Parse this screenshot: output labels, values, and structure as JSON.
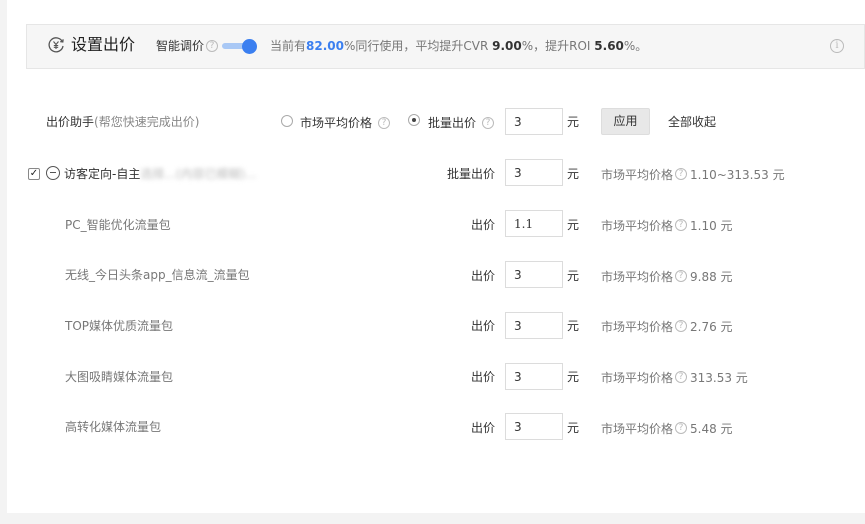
{
  "header": {
    "title": "设置出价",
    "smart_label": "智能调价",
    "stats_prefix": "当前有",
    "stats_pct": "82.00",
    "stats_mid": "%同行使用，平均提升CVR ",
    "stats_cvr": "9.00",
    "stats_mid2": "%，提升ROI ",
    "stats_roi": "5.60",
    "stats_suffix": "%。",
    "smart_toggle_on": true,
    "accent_color": "#3b7ff0"
  },
  "assistant": {
    "label": "出价助手",
    "hint": "(帮您快速完成出价)",
    "option_market": "市场平均价格",
    "option_batch": "批量出价",
    "selected": "批量出价",
    "value": "3",
    "unit": "元",
    "apply_label": "应用",
    "collapse_all_label": "全部收起"
  },
  "group": {
    "checked": true,
    "name_visible": "访客定向-自主",
    "name_blurred": "选择...(内容已模糊)...",
    "bid_label": "批量出价",
    "value": "3",
    "unit": "元",
    "market_label": "市场平均价格",
    "market_value": "1.10~313.53 元"
  },
  "rows": [
    {
      "name": "PC_智能优化流量包",
      "bid_label": "出价",
      "value": "1.1",
      "unit": "元",
      "market_label": "市场平均价格",
      "market_value": "1.10 元"
    },
    {
      "name": "无线_今日头条app_信息流_流量包",
      "bid_label": "出价",
      "value": "3",
      "unit": "元",
      "market_label": "市场平均价格",
      "market_value": "9.88 元"
    },
    {
      "name": "TOP媒体优质流量包",
      "bid_label": "出价",
      "value": "3",
      "unit": "元",
      "market_label": "市场平均价格",
      "market_value": "2.76 元"
    },
    {
      "name": "大图吸睛媒体流量包",
      "bid_label": "出价",
      "value": "3",
      "unit": "元",
      "market_label": "市场平均价格",
      "market_value": "313.53 元"
    },
    {
      "name": "高转化媒体流量包",
      "bid_label": "出价",
      "value": "3",
      "unit": "元",
      "market_label": "市场平均价格",
      "market_value": "5.48 元"
    }
  ]
}
